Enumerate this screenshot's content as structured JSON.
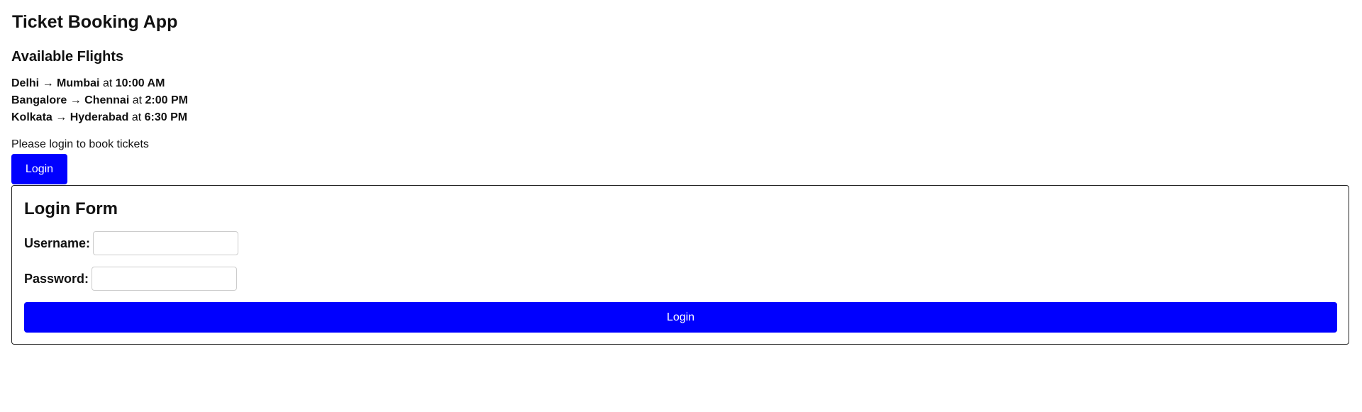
{
  "app": {
    "title": "Ticket Booking App"
  },
  "flights": {
    "heading": "Available Flights",
    "connector": "at",
    "arrow": "→",
    "items": [
      {
        "from": "Delhi",
        "to": "Mumbai",
        "time": "10:00 AM"
      },
      {
        "from": "Bangalore",
        "to": "Chennai",
        "time": "2:00 PM"
      },
      {
        "from": "Kolkata",
        "to": "Hyderabad",
        "time": "6:30 PM"
      }
    ]
  },
  "auth": {
    "prompt": "Please login to book tickets",
    "login_button_label": "Login"
  },
  "login_form": {
    "title": "Login Form",
    "username_label": "Username:",
    "username_value": "",
    "username_placeholder": "",
    "password_label": "Password:",
    "password_value": "",
    "password_placeholder": "",
    "submit_label": "Login"
  },
  "colors": {
    "accent": "#0000ff",
    "button_text": "#ffffff",
    "form_border": "#222222",
    "input_border": "#cccccc"
  }
}
